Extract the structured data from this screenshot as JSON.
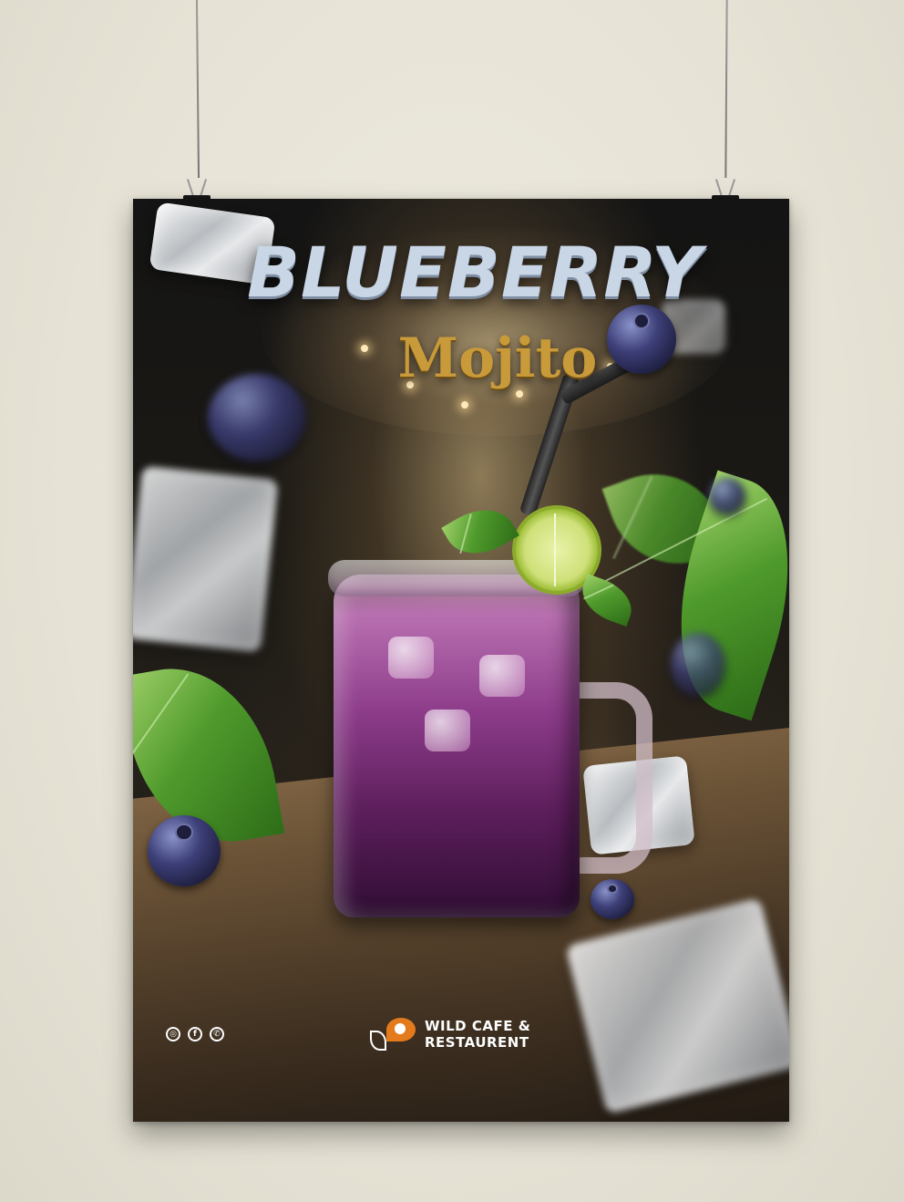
{
  "poster": {
    "title": "BLUEBERRY",
    "subtitle": "Mojito"
  },
  "footer": {
    "social": [
      {
        "icon": "instagram-icon",
        "glyph": "◎"
      },
      {
        "icon": "facebook-icon",
        "glyph": "f"
      },
      {
        "icon": "whatsapp-icon",
        "glyph": "✆"
      }
    ],
    "brand_line1": "WILD CAFE &",
    "brand_line2": "RESTAURENT",
    "brand_logo_icon": "wild-cafe-logo-icon"
  },
  "colors": {
    "wall": "#e6e2d5",
    "poster_background": "#1b1915",
    "title_blue": "#c9d6e6",
    "title_gold": "#c99a3a",
    "drink_purple": "#8d3c8a",
    "brand_orange": "#e37b1d"
  }
}
